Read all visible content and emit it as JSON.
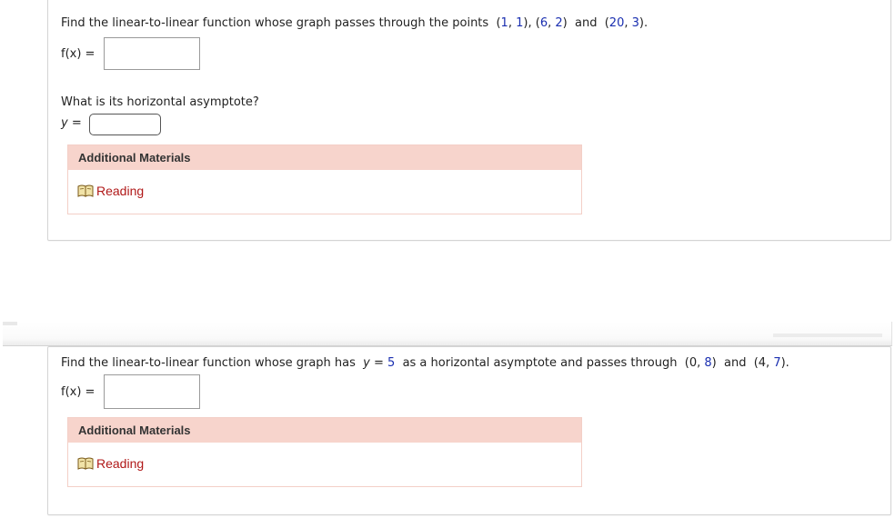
{
  "q1": {
    "prompt_pre": "Find the linear-to-linear function whose graph passes through the points",
    "points": [
      "(1, 1)",
      "(6, 2)",
      "(20, 3)"
    ],
    "p1_open": "(",
    "p1_a": "1",
    "p1_sep": ", ",
    "p1_b": "1",
    "p1_close": "),",
    "p2_open": "(",
    "p2_a": "6",
    "p2_sep": ", ",
    "p2_b": "2",
    "p2_close": ")",
    "and": "and",
    "p3_open": "(",
    "p3_a": "20",
    "p3_sep": ", ",
    "p3_b": "3",
    "p3_close": ").",
    "fx_label": "f(x) =",
    "fx_value": "",
    "asymptote_question": "What is its horizontal asymptote?",
    "y_label": "y =",
    "y_value": "",
    "additional_materials": "Additional Materials",
    "reading_link": "Reading"
  },
  "q2": {
    "prompt_pre": "Find the linear-to-linear function whose graph has",
    "y_eq": "y = ",
    "y_val": "5",
    "prompt_mid": "as a horizontal asymptote and passes through",
    "p1_open": "(0, ",
    "p1_b": "8",
    "p1_close": ")",
    "and": "and",
    "p2_open": "(4, ",
    "p2_b": "7",
    "p2_close": ").",
    "fx_label": "f(x) =",
    "fx_value": "",
    "additional_materials": "Additional Materials",
    "reading_link": "Reading"
  },
  "colors": {
    "number_accent": "#1a2fb0",
    "link": "#b01818",
    "am_header": "#f7d4cc"
  },
  "icons": {
    "reading": "book-icon"
  }
}
